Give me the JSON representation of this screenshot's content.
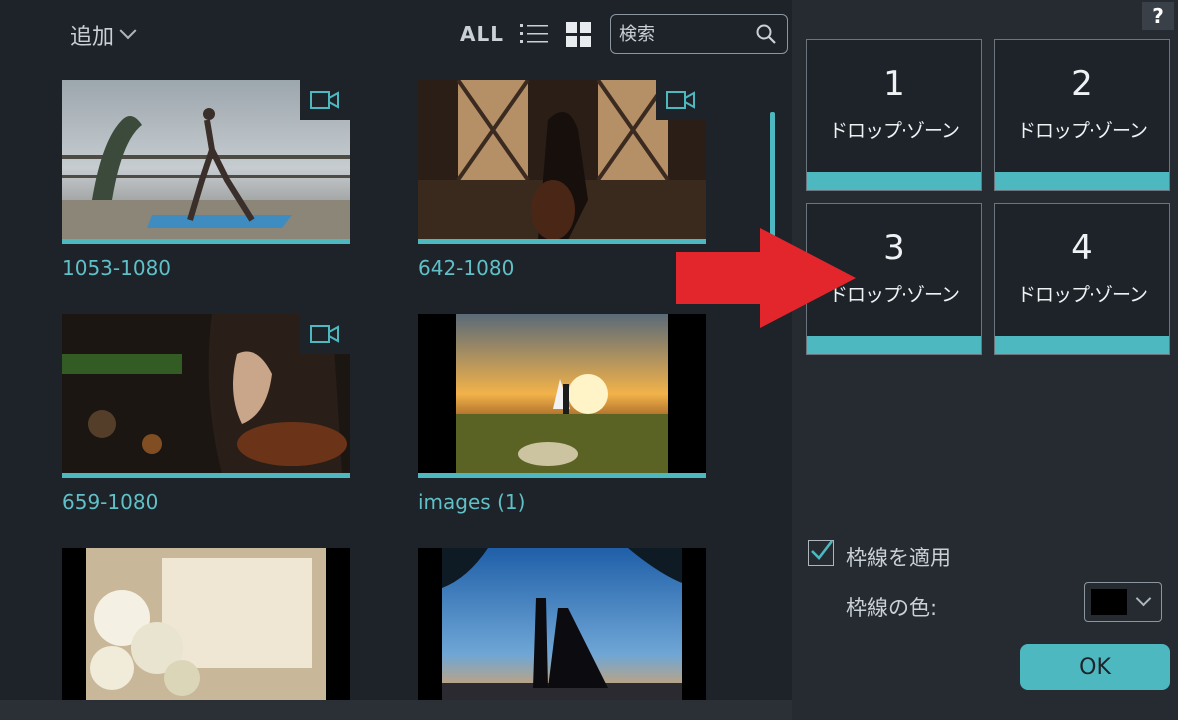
{
  "toolbar": {
    "add_label": "追加",
    "all_label": "ALL",
    "search_placeholder": "検索"
  },
  "media": [
    {
      "label": "1053-1080",
      "type": "video"
    },
    {
      "label": "642-1080",
      "type": "video"
    },
    {
      "label": "659-1080",
      "type": "video"
    },
    {
      "label": "images (1)",
      "type": "image"
    },
    {
      "label": "",
      "type": "image"
    },
    {
      "label": "",
      "type": "image"
    }
  ],
  "zones": [
    {
      "num": "1",
      "label": "ドロップ·ゾーン"
    },
    {
      "num": "2",
      "label": "ドロップ·ゾーン"
    },
    {
      "num": "3",
      "label": "ドロップ·ゾーン"
    },
    {
      "num": "4",
      "label": "ドロップ·ゾーン"
    }
  ],
  "options": {
    "help": "?",
    "border_apply_label": "枠線を適用",
    "border_apply_checked": true,
    "border_color_label": "枠線の色:",
    "border_color": "#000000",
    "ok_label": "OK"
  },
  "colors": {
    "accent": "#4db8c0",
    "arrow": "#e3262b",
    "background": "#1e2329",
    "panel": "#262b31"
  }
}
